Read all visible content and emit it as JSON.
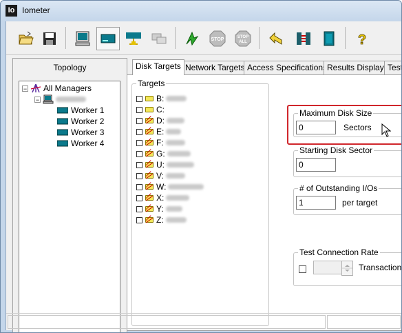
{
  "window": {
    "title": "Iometer",
    "app_icon_text": "Io"
  },
  "toolbar": {
    "buttons": [
      {
        "name": "open-icon"
      },
      {
        "name": "save-icon"
      },
      {
        "name": "start-new-manager-icon"
      },
      {
        "name": "start-disk-worker-icon"
      },
      {
        "name": "start-network-worker-icon"
      },
      {
        "name": "duplicate-worker-icon"
      },
      {
        "name": "start-tests-icon"
      },
      {
        "name": "stop-icon",
        "label": "STOP"
      },
      {
        "name": "stop-all-icon",
        "label": "STOP ALL"
      },
      {
        "name": "reset-icon"
      },
      {
        "name": "disconnect-icon"
      },
      {
        "name": "exit-icon"
      },
      {
        "name": "help-icon",
        "label": "?"
      }
    ]
  },
  "topology": {
    "title": "Topology",
    "root": "All Managers",
    "workers": [
      "Worker 1",
      "Worker 2",
      "Worker 3",
      "Worker 4"
    ]
  },
  "tabs": [
    "Disk Targets",
    "Network Targets",
    "Access Specifications",
    "Results Display",
    "Test"
  ],
  "targets": {
    "legend": "Targets",
    "drives": [
      {
        "letter": "B:",
        "crossed": false
      },
      {
        "letter": "C:",
        "crossed": false
      },
      {
        "letter": "D:",
        "crossed": true
      },
      {
        "letter": "E:",
        "crossed": true
      },
      {
        "letter": "F:",
        "crossed": true
      },
      {
        "letter": "G:",
        "crossed": true
      },
      {
        "letter": "U:",
        "crossed": true
      },
      {
        "letter": "V:",
        "crossed": true
      },
      {
        "letter": "W:",
        "crossed": true
      },
      {
        "letter": "X:",
        "crossed": true
      },
      {
        "letter": "Y:",
        "crossed": true
      },
      {
        "letter": "Z:",
        "crossed": true
      }
    ]
  },
  "max_disk_size": {
    "legend": "Maximum Disk Size",
    "value": "0",
    "unit": "Sectors"
  },
  "starting_disk_sector": {
    "legend": "Starting Disk Sector",
    "value": "0"
  },
  "outstanding_ios": {
    "legend": "# of Outstanding I/Os",
    "value": "1",
    "unit": "per target"
  },
  "test_connection_rate": {
    "legend": "Test Connection Rate",
    "unit": "Transactions p"
  },
  "colors": {
    "highlight": "#d0262b",
    "titlebar": "#c4d6ea"
  }
}
